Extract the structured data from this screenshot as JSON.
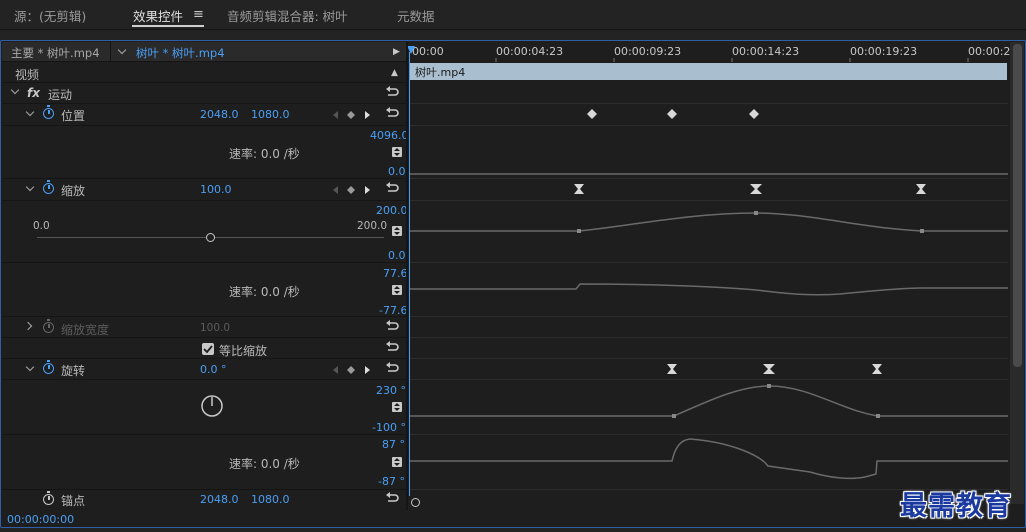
{
  "tabs": [
    {
      "label": "源：(无剪辑)"
    },
    {
      "label": "效果控件"
    },
    {
      "label": "音频剪辑混合器: 树叶"
    },
    {
      "label": "元数据"
    }
  ],
  "tab_menu_icon": "hamburger-menu-icon",
  "sequence": {
    "master_label": "主要 * 树叶.mp4",
    "clip_label": "树叶 * 树叶.mp4"
  },
  "timeline": {
    "ticks": [
      "00:00",
      "00:00:04:23",
      "00:00:09:23",
      "00:00:14:23",
      "00:00:19:23",
      "00:00:2"
    ],
    "clip_name": "树叶.mp4",
    "current_time": "00:00:00:00"
  },
  "effects": {
    "section_label": "视频",
    "fx_label": "fx",
    "motion_label": "运动",
    "position": {
      "label": "位置",
      "x": "2048.0",
      "y": "1080.0",
      "max": "4096.0",
      "min": "0.0",
      "speed": "速率: 0.0 /秒"
    },
    "scale": {
      "label": "缩放",
      "value": "100.0",
      "graph_max": "200.0",
      "graph_min": "0.0",
      "slider_min": "0.0",
      "slider_max": "200.0",
      "slider_fraction": 0.5,
      "vel_max": "77.6",
      "vel_min": "-77.6",
      "speed": "速率: 0.0 /秒"
    },
    "scale_width": {
      "label": "缩放宽度",
      "value": "100.0"
    },
    "uniform_scale": {
      "label": "等比缩放",
      "checked": true
    },
    "rotation": {
      "label": "旋转",
      "value": "0.0 °",
      "graph_max": "230 °",
      "graph_min": "-100 °",
      "vel_max": "87 °",
      "vel_min": "-87 °",
      "speed": "速率: 0.0 /秒"
    },
    "anchor": {
      "label": "锚点",
      "x": "2048.0",
      "y": "1080.0"
    }
  },
  "watermark": "最需教育",
  "colors": {
    "accent_blue": "#4a9ff5",
    "panel_border": "#2f5fa8",
    "clip_bar": "#a9bfd0"
  }
}
